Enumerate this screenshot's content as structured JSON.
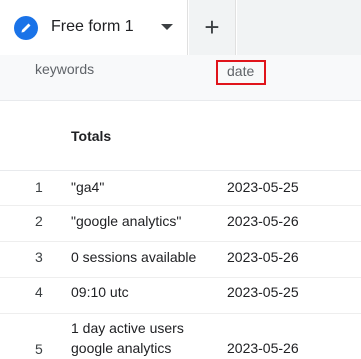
{
  "tabs": {
    "active_label": "Free form 1",
    "add_label": "+"
  },
  "table": {
    "headers": {
      "keywords": "keywords",
      "date": "date"
    },
    "totals_label": "Totals",
    "rows": [
      {
        "index": "1",
        "keyword_line1": "\"ga4\"",
        "keyword_line2": "",
        "date": "2023-05-25"
      },
      {
        "index": "2",
        "keyword_line1": "\"google analytics\"",
        "keyword_line2": "",
        "date": "2023-05-26"
      },
      {
        "index": "3",
        "keyword_line1": "0 sessions available",
        "keyword_line2": "",
        "date": "2023-05-26"
      },
      {
        "index": "4",
        "keyword_line1": "09:10 utc",
        "keyword_line2": "",
        "date": "2023-05-25"
      },
      {
        "index": "5",
        "keyword_line1": "1 day active users",
        "keyword_line2": "google analytics",
        "date": "2023-05-26"
      }
    ]
  },
  "colors": {
    "accent": "#1a73e8",
    "highlight_border": "#e0141b"
  },
  "icons": {
    "tab_icon": "pencil-icon",
    "tab_menu": "caret-down-icon",
    "add_tab": "plus-icon"
  }
}
